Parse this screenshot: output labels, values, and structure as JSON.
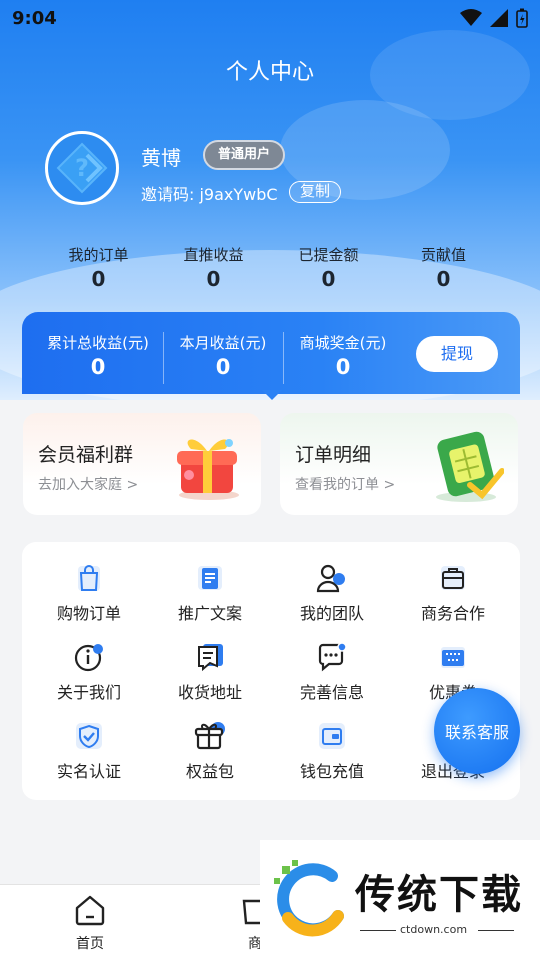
{
  "status_bar": {
    "time": "9:04"
  },
  "header": {
    "title": "个人中心"
  },
  "user": {
    "name": "黄博",
    "badge": "普通用户",
    "invite_label": "邀请码: j9axYwbC",
    "copy_label": "复制"
  },
  "stats": [
    {
      "label": "我的订单",
      "value": "0"
    },
    {
      "label": "直推收益",
      "value": "0"
    },
    {
      "label": "已提金额",
      "value": "0"
    },
    {
      "label": "贡献值",
      "value": "0"
    }
  ],
  "earnings": {
    "items": [
      {
        "label": "累计总收益(元)",
        "value": "0"
      },
      {
        "label": "本月收益(元)",
        "value": "0"
      },
      {
        "label": "商城奖金(元)",
        "value": "0"
      }
    ],
    "withdraw_label": "提现"
  },
  "promos": [
    {
      "title": "会员福利群",
      "subtitle": "去加入大家庭 >"
    },
    {
      "title": "订单明细",
      "subtitle": "查看我的订单 >"
    }
  ],
  "menu": [
    {
      "label": "购物订单",
      "icon": "shopping-bag-icon"
    },
    {
      "label": "推广文案",
      "icon": "document-icon"
    },
    {
      "label": "我的团队",
      "icon": "team-icon"
    },
    {
      "label": "商务合作",
      "icon": "briefcase-icon"
    },
    {
      "label": "关于我们",
      "icon": "info-icon"
    },
    {
      "label": "收货地址",
      "icon": "address-icon"
    },
    {
      "label": "完善信息",
      "icon": "chat-info-icon"
    },
    {
      "label": "优惠券",
      "icon": "coupon-icon"
    },
    {
      "label": "实名认证",
      "icon": "shield-check-icon"
    },
    {
      "label": "权益包",
      "icon": "gift-box-icon"
    },
    {
      "label": "钱包充值",
      "icon": "wallet-icon"
    },
    {
      "label": "退出登录",
      "icon": "logout-icon"
    }
  ],
  "floating_button": {
    "label": "联系客服"
  },
  "tabbar": [
    {
      "label": "首页",
      "icon": "home-icon"
    },
    {
      "label": "商",
      "icon": "shop-icon"
    }
  ],
  "watermark": {
    "text": "传统下载",
    "url": "ctdown.com"
  },
  "colors": {
    "primary": "#1e6ef0",
    "hero_top": "#1f7ff1",
    "accent_cs": "#1470ef"
  }
}
